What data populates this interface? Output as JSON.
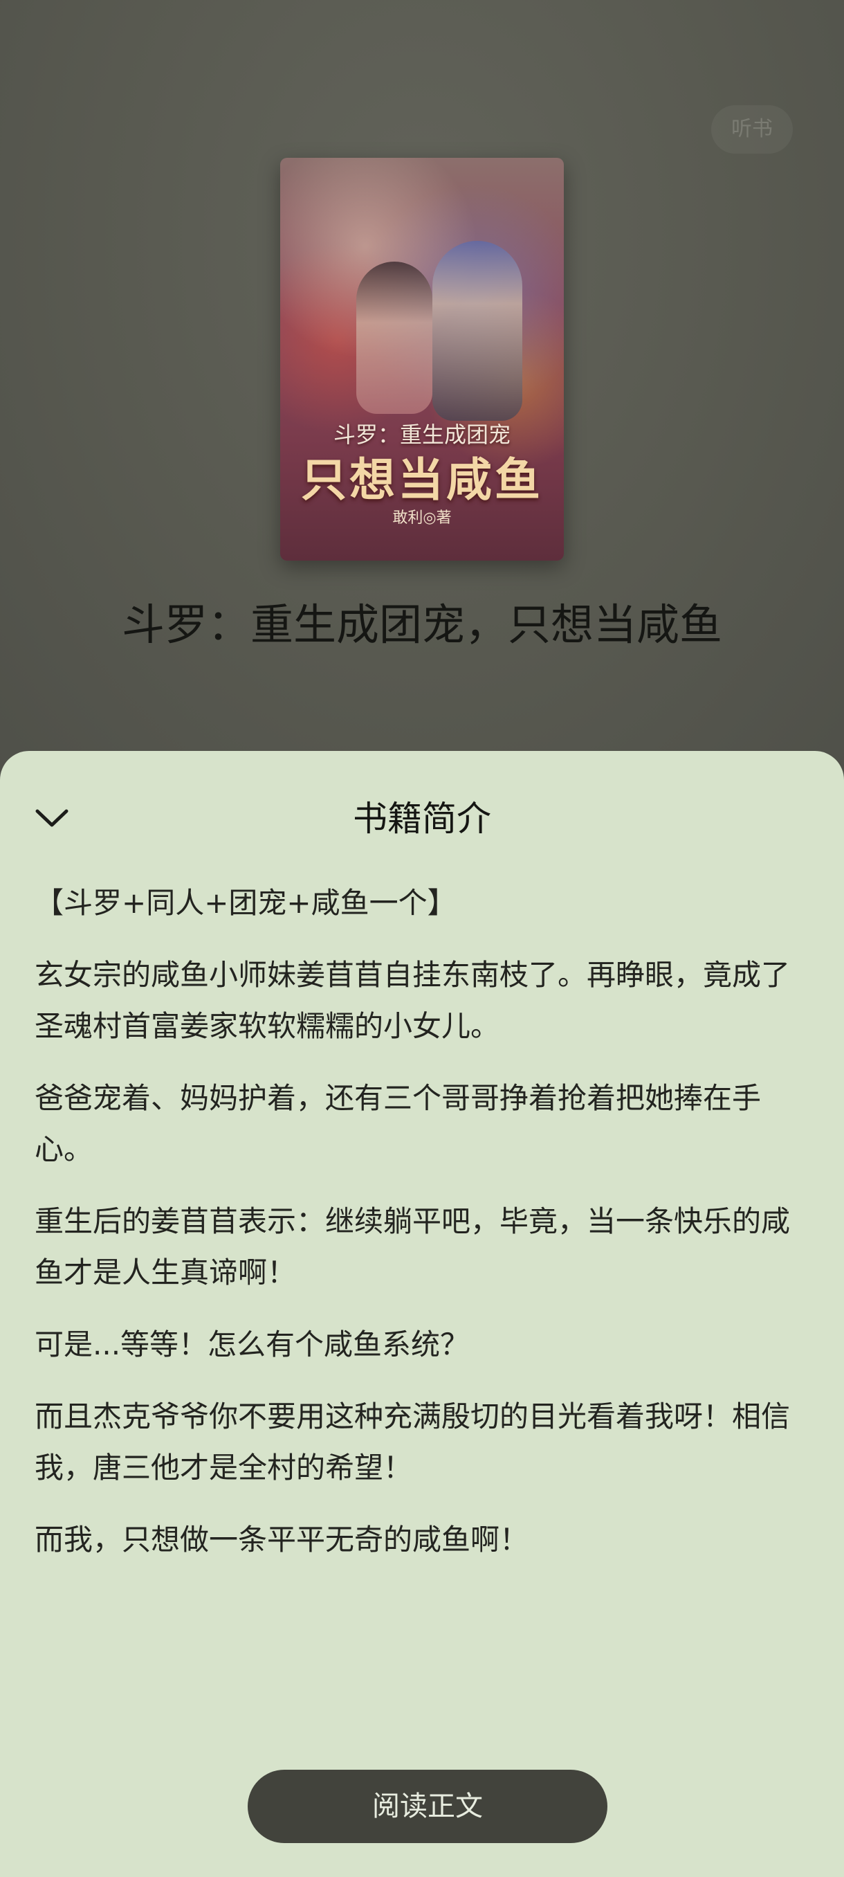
{
  "header": {
    "listen_label": "听书"
  },
  "cover": {
    "subtitle": "斗罗：重生成团宠",
    "title": "只想当咸鱼",
    "author": "敢利◎著"
  },
  "book": {
    "title": "斗罗：重生成团宠，只想当咸鱼"
  },
  "sheet": {
    "title": "书籍简介",
    "paragraphs": [
      "【斗罗+同人+团宠+咸鱼一个】",
      "玄女宗的咸鱼小师妹姜苜苜自挂东南枝了。再睁眼，竟成了圣魂村首富姜家软软糯糯的小女儿。",
      "爸爸宠着、妈妈护着，还有三个哥哥挣着抢着把她捧在手心。",
      "重生后的姜苜苜表示：继续躺平吧，毕竟，当一条快乐的咸鱼才是人生真谛啊！",
      "可是...等等！怎么有个咸鱼系统？",
      "而且杰克爷爷你不要用这种充满殷切的目光看着我呀！相信我，唐三他才是全村的希望！",
      "而我，只想做一条平平无奇的咸鱼啊！"
    ]
  },
  "footer": {
    "read_label": "阅读正文"
  },
  "colors": {
    "backdrop": "#55564f",
    "sheet": "#d7e3cb",
    "button": "#42433c",
    "button_text": "#e8ede0"
  }
}
